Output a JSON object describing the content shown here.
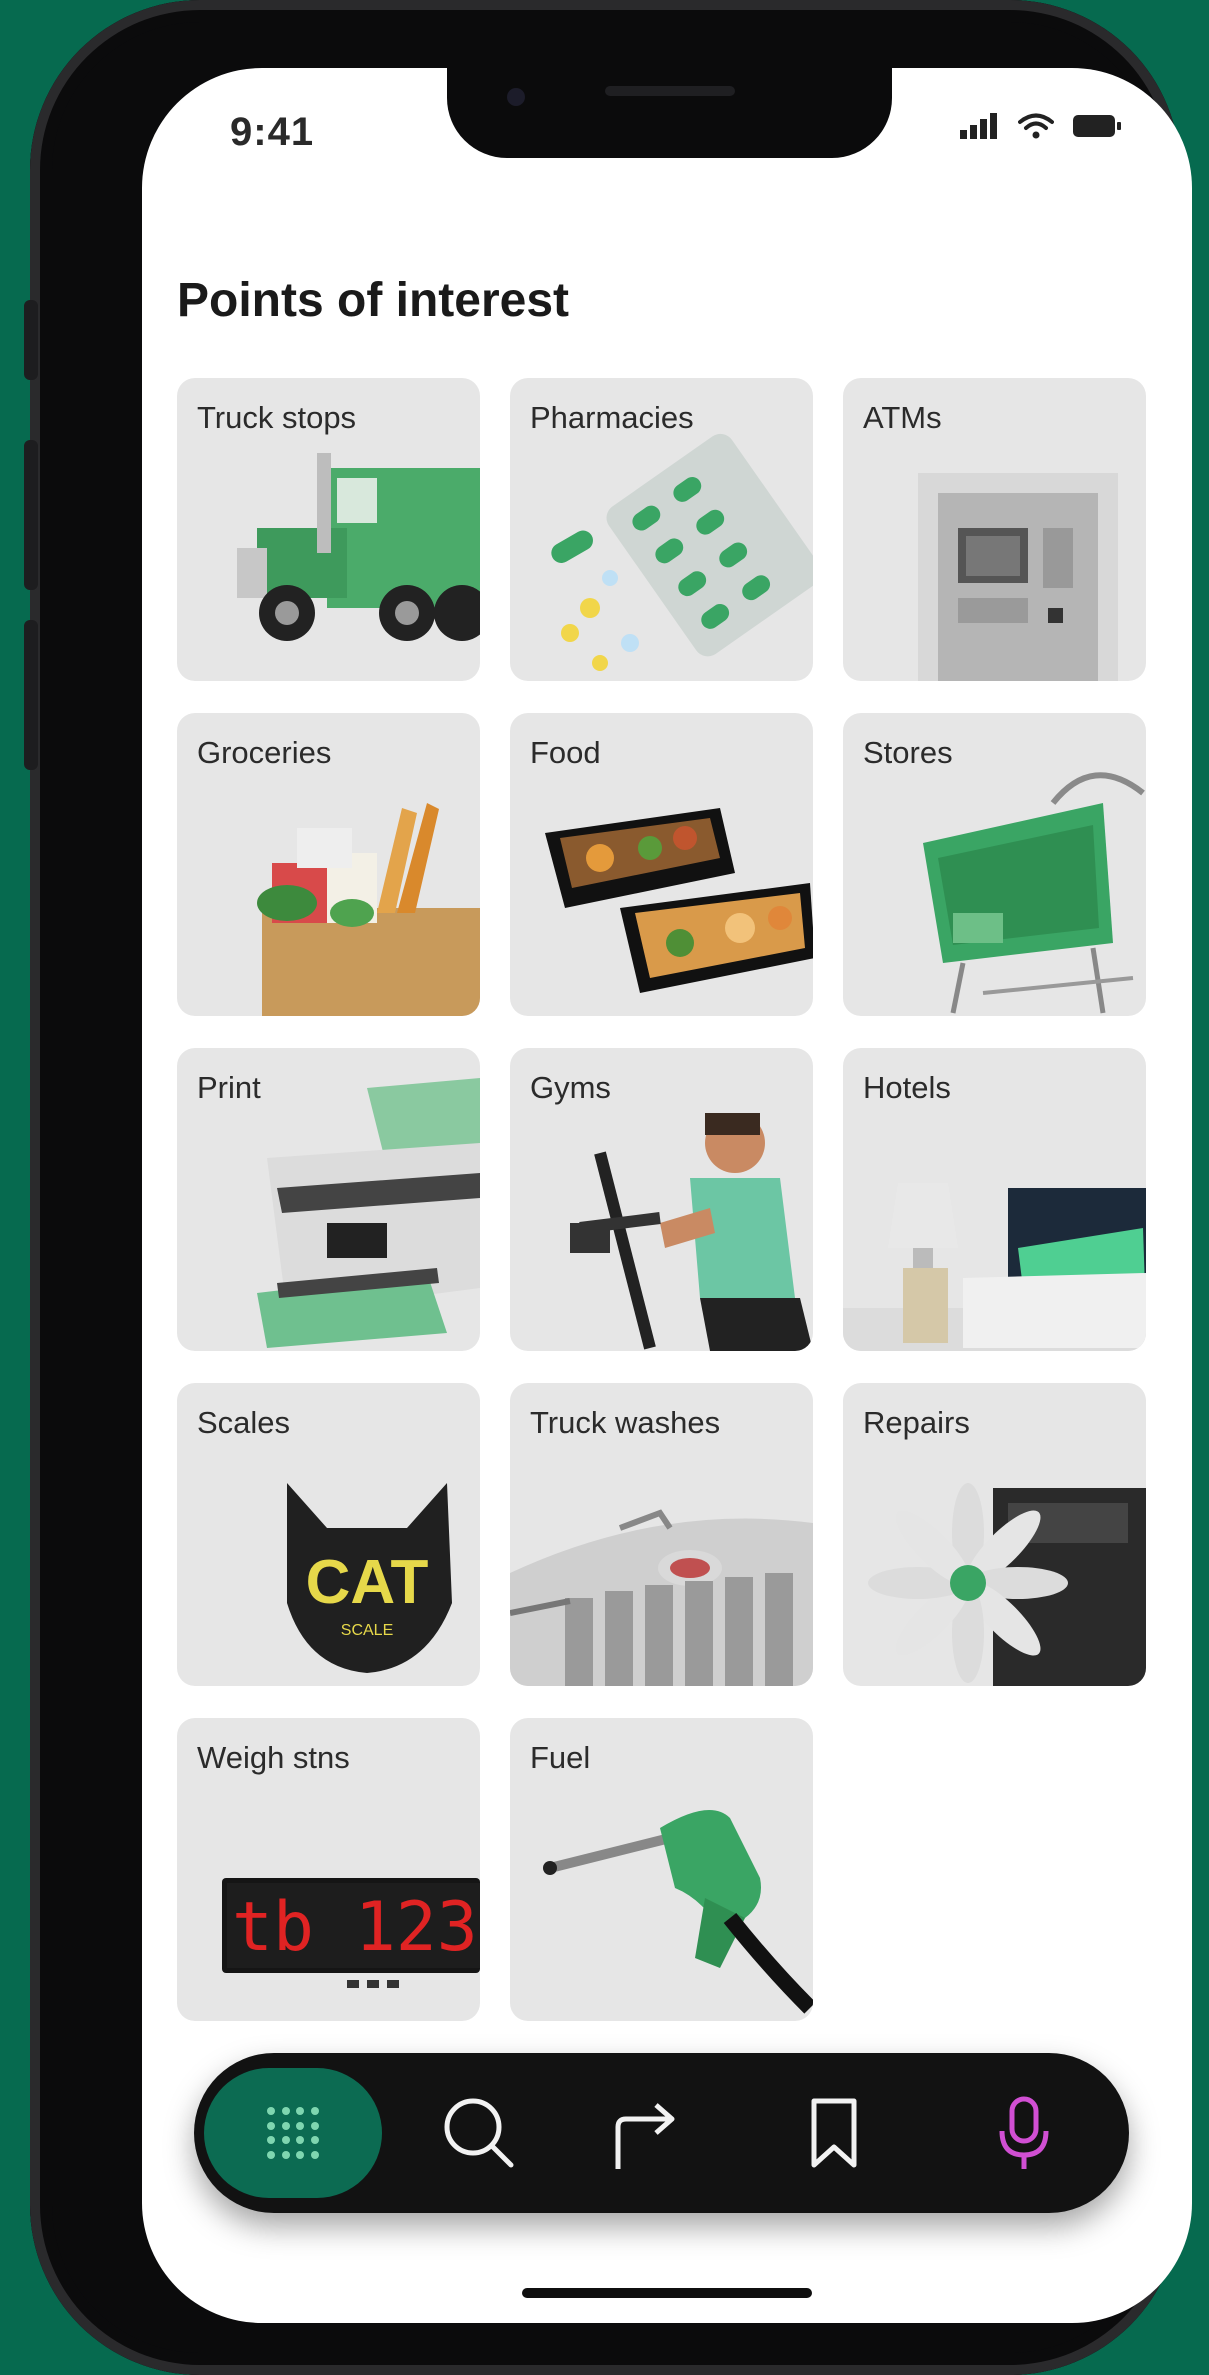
{
  "status_bar": {
    "time": "9:41",
    "signal_icon": "signal-bars-icon",
    "wifi_icon": "wifi-icon",
    "battery_icon": "battery-icon"
  },
  "page": {
    "title": "Points of interest"
  },
  "categories": [
    {
      "label": "Truck stops",
      "icon": "truck-icon"
    },
    {
      "label": "Pharmacies",
      "icon": "pills-icon"
    },
    {
      "label": "ATMs",
      "icon": "atm-icon"
    },
    {
      "label": "Groceries",
      "icon": "grocery-bag-icon"
    },
    {
      "label": "Food",
      "icon": "food-container-icon"
    },
    {
      "label": "Stores",
      "icon": "shopping-cart-icon"
    },
    {
      "label": "Print",
      "icon": "printer-icon"
    },
    {
      "label": "Gyms",
      "icon": "gym-icon"
    },
    {
      "label": "Hotels",
      "icon": "hotel-bed-icon"
    },
    {
      "label": "Scales",
      "icon": "cat-scale-logo-icon"
    },
    {
      "label": "Truck washes",
      "icon": "truck-wash-icon"
    },
    {
      "label": "Repairs",
      "icon": "engine-icon"
    },
    {
      "label": "Weigh stns",
      "icon": "weigh-display-icon"
    },
    {
      "label": "Fuel",
      "icon": "fuel-nozzle-icon"
    }
  ],
  "scale_logo_text": "CAT",
  "scale_logo_subtext": "SCALE",
  "weigh_display_text": "tb 123",
  "bottom_nav": [
    {
      "name": "grid-menu",
      "icon": "grid-dots-icon",
      "active": true
    },
    {
      "name": "search",
      "icon": "search-icon",
      "active": false
    },
    {
      "name": "directions",
      "icon": "turn-arrow-icon",
      "active": false
    },
    {
      "name": "saved",
      "icon": "bookmark-icon",
      "active": false
    },
    {
      "name": "voice",
      "icon": "microphone-icon",
      "active": false
    }
  ],
  "colors": {
    "background": "#066a4f",
    "accent": "#0c6b52",
    "tile": "#e6e6e6",
    "brand_green": "#3aa564",
    "mic": "#d14fd3"
  }
}
